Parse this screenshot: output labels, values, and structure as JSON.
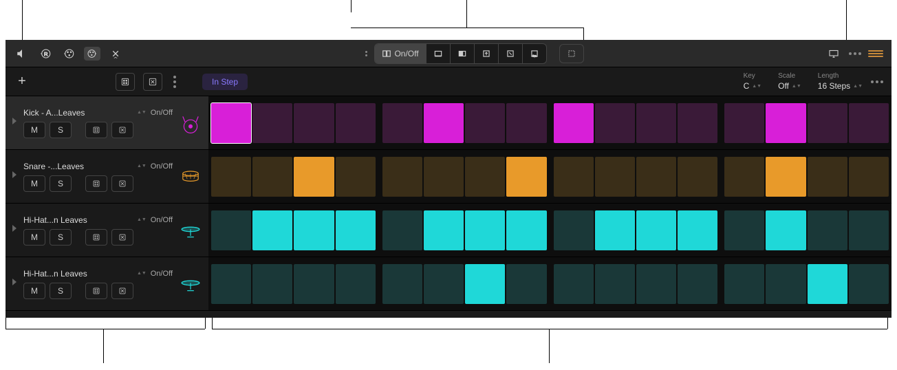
{
  "toolbar": {
    "mode_onoff": "On/Off"
  },
  "subheader": {
    "in_step": "In Step",
    "params": [
      {
        "label": "Key",
        "value": "C"
      },
      {
        "label": "Scale",
        "value": "Off"
      },
      {
        "label": "Length",
        "value": "16 Steps"
      }
    ]
  },
  "track_labels": {
    "mute": "M",
    "solo": "S",
    "onoff": "On/Off"
  },
  "tracks": [
    {
      "name": "Kick - A...Leaves",
      "color_on": "#d81fd8",
      "color_off": "#3a1a38",
      "instrument": "kick",
      "pattern": [
        1,
        0,
        0,
        0,
        0,
        1,
        0,
        0,
        1,
        0,
        0,
        0,
        0,
        1,
        0,
        0
      ]
    },
    {
      "name": "Snare -...Leaves",
      "color_on": "#e89a2a",
      "color_off": "#3a2e18",
      "instrument": "snare",
      "pattern": [
        0,
        0,
        1,
        0,
        0,
        0,
        0,
        1,
        0,
        0,
        0,
        0,
        0,
        1,
        0,
        0
      ]
    },
    {
      "name": "Hi-Hat...n Leaves",
      "color_on": "#1fd8d8",
      "color_off": "#1a3838",
      "instrument": "hihat",
      "pattern": [
        0,
        1,
        1,
        1,
        0,
        1,
        1,
        1,
        0,
        1,
        1,
        1,
        0,
        1,
        0,
        0
      ]
    },
    {
      "name": "Hi-Hat...n Leaves",
      "color_on": "#1fd8d8",
      "color_off": "#1a3838",
      "instrument": "hihat",
      "pattern": [
        0,
        0,
        0,
        0,
        0,
        0,
        1,
        0,
        0,
        0,
        0,
        0,
        0,
        0,
        1,
        0
      ]
    }
  ]
}
